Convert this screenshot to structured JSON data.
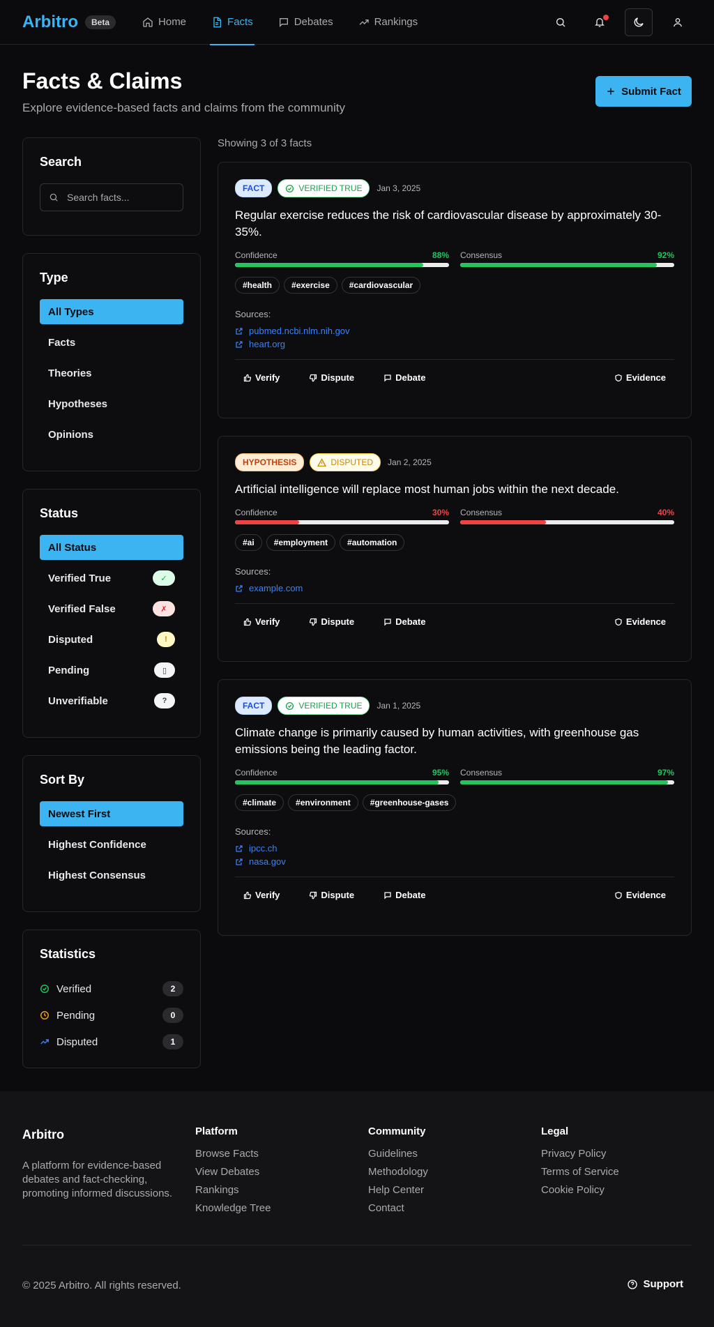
{
  "nav": {
    "brand": "Arbitro",
    "beta": "Beta",
    "items": [
      {
        "label": "Home",
        "icon": "home-icon"
      },
      {
        "label": "Facts",
        "icon": "document-icon"
      },
      {
        "label": "Debates",
        "icon": "message-icon"
      },
      {
        "label": "Rankings",
        "icon": "trending-up-icon"
      }
    ]
  },
  "header": {
    "title": "Facts & Claims",
    "subtitle": "Explore evidence-based facts and claims from the community",
    "submit_label": "Submit Fact"
  },
  "sidebar": {
    "search": {
      "title": "Search",
      "placeholder": "Search facts..."
    },
    "type": {
      "title": "Type",
      "options": [
        "All Types",
        "Facts",
        "Theories",
        "Hypotheses",
        "Opinions"
      ]
    },
    "status": {
      "title": "Status",
      "options": [
        {
          "label": "All Status",
          "badge": ""
        },
        {
          "label": "Verified True",
          "badge": "✓"
        },
        {
          "label": "Verified False",
          "badge": "✗"
        },
        {
          "label": "Disputed",
          "badge": "!"
        },
        {
          "label": "Pending",
          "badge": "▯"
        },
        {
          "label": "Unverifiable",
          "badge": "?"
        }
      ]
    },
    "sort": {
      "title": "Sort By",
      "options": [
        "Newest First",
        "Highest Confidence",
        "Highest Consensus"
      ]
    },
    "stats": {
      "title": "Statistics",
      "items": [
        {
          "label": "Verified",
          "count": "2"
        },
        {
          "label": "Pending",
          "count": "0"
        },
        {
          "label": "Disputed",
          "count": "1"
        }
      ]
    }
  },
  "main": {
    "showing": "Showing 3 of 3 facts",
    "labels": {
      "confidence": "Confidence",
      "consensus": "Consensus",
      "sources": "Sources:",
      "verify": "Verify",
      "dispute": "Dispute",
      "debate": "Debate",
      "evidence": "Evidence"
    },
    "facts": [
      {
        "type": "FACT",
        "status": "VERIFIED TRUE",
        "date": "Jan 3, 2025",
        "claim": "Regular exercise reduces the risk of cardiovascular disease by approximately 30-35%.",
        "confidence": "88%",
        "consensus": "92%",
        "tags": [
          "#health",
          "#exercise",
          "#cardiovascular"
        ],
        "sources": [
          "pubmed.ncbi.nlm.nih.gov",
          "heart.org"
        ]
      },
      {
        "type": "HYPOTHESIS",
        "status": "DISPUTED",
        "date": "Jan 2, 2025",
        "claim": "Artificial intelligence will replace most human jobs within the next decade.",
        "confidence": "30%",
        "consensus": "40%",
        "tags": [
          "#ai",
          "#employment",
          "#automation"
        ],
        "sources": [
          "example.com"
        ]
      },
      {
        "type": "FACT",
        "status": "VERIFIED TRUE",
        "date": "Jan 1, 2025",
        "claim": "Climate change is primarily caused by human activities, with greenhouse gas emissions being the leading factor.",
        "confidence": "95%",
        "consensus": "97%",
        "tags": [
          "#climate",
          "#environment",
          "#greenhouse-gases"
        ],
        "sources": [
          "ipcc.ch",
          "nasa.gov"
        ]
      }
    ]
  },
  "footer": {
    "brand": "Arbitro",
    "description": "A platform for evidence-based debates and fact-checking, promoting informed discussions.",
    "columns": [
      {
        "title": "Platform",
        "links": [
          "Browse Facts",
          "View Debates",
          "Rankings",
          "Knowledge Tree"
        ]
      },
      {
        "title": "Community",
        "links": [
          "Guidelines",
          "Methodology",
          "Help Center",
          "Contact"
        ]
      },
      {
        "title": "Legal",
        "links": [
          "Privacy Policy",
          "Terms of Service",
          "Cookie Policy"
        ]
      }
    ],
    "copyright": "© 2025 Arbitro. All rights reserved.",
    "support": "Support"
  },
  "colors": {
    "accent": "#3db4f2",
    "success": "#22c55e",
    "danger": "#ef4444",
    "warning": "#f59e0b",
    "link": "#3b82f6"
  }
}
